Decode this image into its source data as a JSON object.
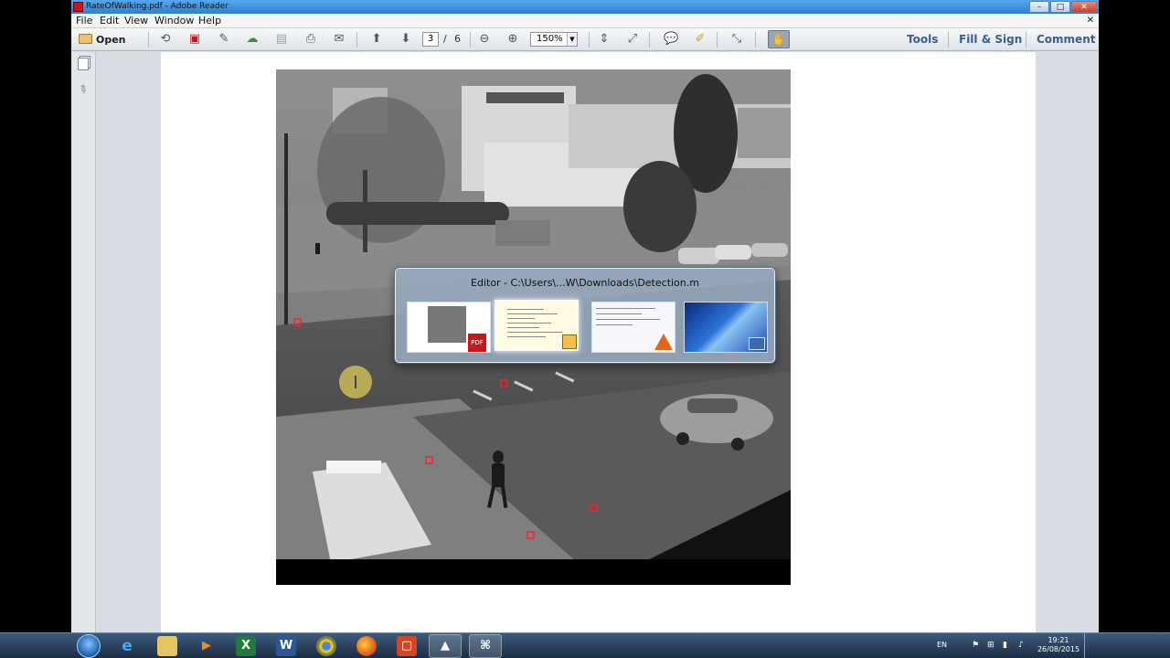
{
  "window": {
    "title": "RateOfWalking.pdf - Adobe Reader",
    "min_label": "–",
    "max_label": "□",
    "close_label": "✕"
  },
  "menubar": {
    "file": "File",
    "edit": "Edit",
    "view": "View",
    "window": "Window",
    "help": "Help",
    "doc_close": "✕"
  },
  "toolbar": {
    "open_label": "Open",
    "page_current": "3",
    "page_separator": "/",
    "page_total": "6",
    "zoom_value": "150%",
    "tools_label": "Tools",
    "fill_sign_label": "Fill & Sign",
    "comment_label": "Comment",
    "icons": [
      "create-pdf-icon",
      "export-pdf-icon",
      "edit-icon",
      "upload-icon",
      "save-icon",
      "print-icon",
      "email-icon",
      "page-up-icon",
      "page-down-icon",
      "zoom-out-icon",
      "zoom-in-icon",
      "fit-page-icon",
      "fit-width-icon",
      "comment-icon",
      "highlight-icon",
      "fullscreen-icon",
      "hand-icon"
    ]
  },
  "switcher": {
    "title": "Editor - C:\\Users\\...W\\Downloads\\Detection.m",
    "thumbnails": [
      "pdf-window-thumbnail",
      "matlab-editor-thumbnail",
      "matlab-window-thumbnail",
      "desktop-thumbnail"
    ]
  },
  "colors": {
    "titlebar": "#2d7fd2",
    "link": "#3b5f89",
    "detection_box": "#ff2020",
    "taskbar": "#1b2d44"
  },
  "taskbar": {
    "apps": [
      "ie-icon",
      "explorer-icon",
      "media-player-icon",
      "excel-icon",
      "word-icon",
      "chrome-icon",
      "firefox-icon",
      "office-icon",
      "matlab-icon",
      "adobe-reader-icon"
    ],
    "excel_glyph": "X",
    "word_glyph": "W",
    "ie_glyph": "e",
    "language": "EN",
    "time": "19:21",
    "date": "26/08/2015"
  }
}
